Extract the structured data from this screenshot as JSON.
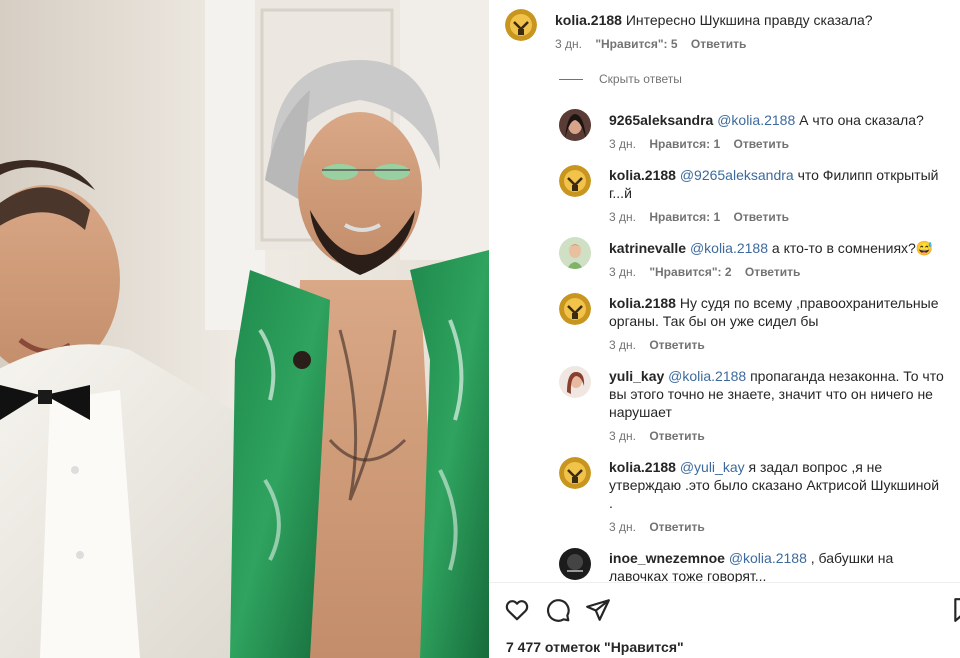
{
  "comments": [
    {
      "username": "kolia.2188",
      "mention": "",
      "text": "Интересно Шукшина правду сказала?",
      "time": "3 дн.",
      "likes": "\"Нравится\": 5",
      "reply": "Ответить"
    }
  ],
  "hide_replies": "Скрыть ответы",
  "replies": [
    {
      "username": "9265aleksandra",
      "mention": "@kolia.2188",
      "text": " А что она сказала?",
      "time": "3 дн.",
      "likes": "Нравится: 1",
      "reply": "Ответить"
    },
    {
      "username": "kolia.2188",
      "mention": "@9265aleksandra",
      "text": " что Филипп открытый г...й",
      "time": "3 дн.",
      "likes": "Нравится: 1",
      "reply": "Ответить"
    },
    {
      "username": "katrinevalle",
      "mention": "@kolia.2188",
      "text": " а кто-то в сомнениях?😅",
      "time": "3 дн.",
      "likes": "\"Нравится\": 2",
      "reply": "Ответить"
    },
    {
      "username": "kolia.2188",
      "mention": "",
      "text": "Ну судя по всему ,правоохранительные органы. Так бы он уже сидел бы",
      "time": "3 дн.",
      "likes": "",
      "reply": "Ответить"
    },
    {
      "username": "yuli_kay",
      "mention": "@kolia.2188",
      "text": " пропаганда незаконна. То что вы этого точно не знаете, значит что он ничего не нарушает",
      "time": "3 дн.",
      "likes": "",
      "reply": "Ответить"
    },
    {
      "username": "kolia.2188",
      "mention": "@yuli_kay",
      "text": " я задал вопрос ,я не утверждаю .это было сказано Актрисой Шукшиной .",
      "time": "3 дн.",
      "likes": "",
      "reply": "Ответить"
    },
    {
      "username": "inoe_wnezemnoe",
      "mention": "@kolia.2188",
      "text": " , бабушки на лавочках тоже говорят...",
      "time": "",
      "likes": "",
      "reply": ""
    }
  ],
  "actions": {
    "like_icon": "heart-icon",
    "comment_icon": "comment-icon",
    "share_icon": "send-icon",
    "save_icon": "bookmark-icon"
  },
  "likes_count": "7 477 отметок \"Нравится\"",
  "colors": {
    "mention": "#3d6a9e",
    "meta": "#737373",
    "text": "#262626"
  }
}
